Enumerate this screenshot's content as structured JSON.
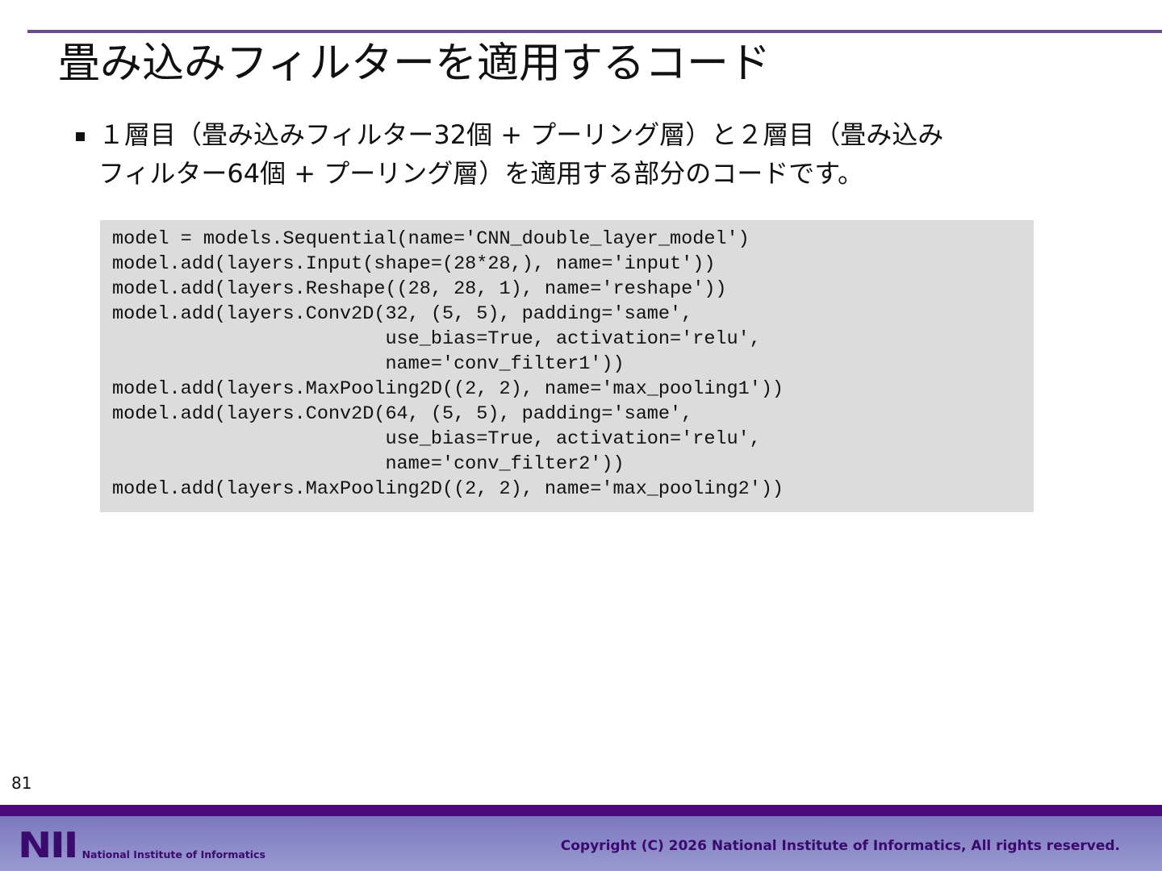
{
  "slide": {
    "title": "畳み込みフィルターを適用するコード",
    "bullet": {
      "lines": [
        "１層目（畳み込みフィルター32個 + プーリング層）と２層目（畳み込み",
        "フィルター64個 + プーリング層）を適用する部分のコードです。"
      ]
    },
    "code": "model = models.Sequential(name='CNN_double_layer_model')\nmodel.add(layers.Input(shape=(28*28,), name='input'))\nmodel.add(layers.Reshape((28, 28, 1), name='reshape'))\nmodel.add(layers.Conv2D(32, (5, 5), padding='same',\n                        use_bias=True, activation='relu',\n                        name='conv_filter1'))\nmodel.add(layers.MaxPooling2D((2, 2), name='max_pooling1'))\nmodel.add(layers.Conv2D(64, (5, 5), padding='same',\n                        use_bias=True, activation='relu',\n                        name='conv_filter2'))\nmodel.add(layers.MaxPooling2D((2, 2), name='max_pooling2'))",
    "page_number": "81"
  },
  "footer": {
    "logo_mark": "NII",
    "logo_text": "National Institute of Informatics",
    "copyright": "Copyright (C) 2026 National Institute of Informatics, All rights reserved."
  },
  "colors": {
    "accent_rule": "#6a4c93",
    "footer_bar": "#4a0a7c",
    "footer_text": "#3a0a6e",
    "code_background": "#dcdcdc"
  }
}
